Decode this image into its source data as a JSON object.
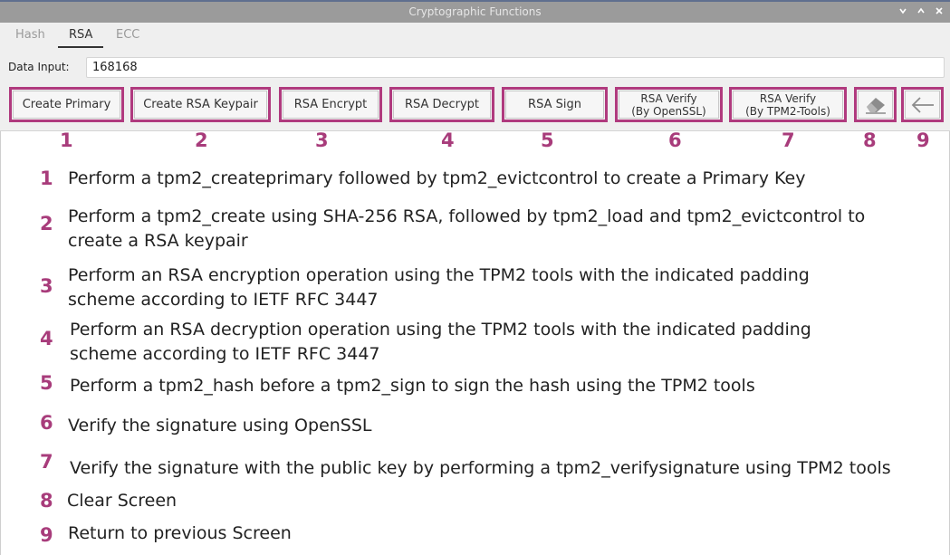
{
  "window": {
    "title": "Cryptographic Functions",
    "controls": [
      "chevron-down",
      "chevron-up",
      "close"
    ]
  },
  "tabs": [
    {
      "label": "Hash",
      "active": false
    },
    {
      "label": "RSA",
      "active": true
    },
    {
      "label": "ECC",
      "active": false
    }
  ],
  "data_input": {
    "label": "Data Input:",
    "value": "168168"
  },
  "buttons": [
    {
      "id": "create-primary",
      "label": "Create Primary",
      "number": "1"
    },
    {
      "id": "create-rsa-keypair",
      "label": "Create RSA Keypair",
      "number": "2"
    },
    {
      "id": "rsa-encrypt",
      "label": "RSA Encrypt",
      "number": "3"
    },
    {
      "id": "rsa-decrypt",
      "label": "RSA Decrypt",
      "number": "4"
    },
    {
      "id": "rsa-sign",
      "label": "RSA Sign",
      "number": "5"
    },
    {
      "id": "rsa-verify-openssl",
      "label_line1": "RSA Verify",
      "label_line2": "(By OpenSSL)",
      "number": "6"
    },
    {
      "id": "rsa-verify-tpm2",
      "label_line1": "RSA Verify",
      "label_line2": "(By TPM2-Tools)",
      "number": "7"
    },
    {
      "id": "clear",
      "icon": "eraser-icon",
      "number": "8"
    },
    {
      "id": "back",
      "icon": "arrow-left-icon",
      "number": "9"
    }
  ],
  "legend": [
    {
      "number": "1",
      "text": "Perform a tpm2_createprimary followed by tpm2_evictcontrol to create a Primary Key"
    },
    {
      "number": "2",
      "line1": "Perform a tpm2_create using SHA-256 RSA, followed by tpm2_load and tpm2_evictcontrol to",
      "line2": "create a RSA keypair"
    },
    {
      "number": "3",
      "line1": "Perform an RSA encryption operation using the TPM2 tools with the indicated padding",
      "line2": "scheme according to IETF RFC 3447"
    },
    {
      "number": "4",
      "line1": "Perform an RSA decryption operation using the TPM2 tools with the indicated padding",
      "line2": "scheme according to IETF RFC 3447"
    },
    {
      "number": "5",
      "text": "Perform a tpm2_hash before a tpm2_sign to sign the hash using the TPM2 tools"
    },
    {
      "number": "6",
      "text": "Verify the signature using OpenSSL"
    },
    {
      "number": "7",
      "text": "Verify the signature with the public key by performing a tpm2_verifysignature using TPM2 tools"
    },
    {
      "number": "8",
      "text": "Clear Screen"
    },
    {
      "number": "9",
      "text": "Return to previous Screen"
    }
  ],
  "colors": {
    "annotation": "#a83c7b",
    "button_border": "#b03a7e",
    "toolbar_bg": "#efefef",
    "titlebar_bg": "#9b9b9b"
  }
}
